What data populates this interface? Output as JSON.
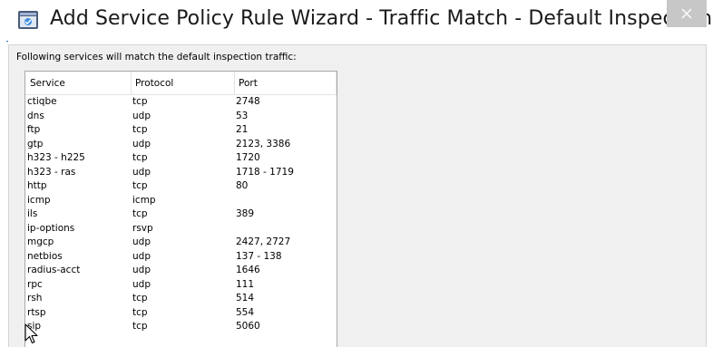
{
  "window": {
    "title": "Add Service Policy Rule Wizard - Traffic Match - Default Inspections",
    "close_glyph": "✕"
  },
  "intro_text": "Following services will match the default inspection traffic:",
  "table": {
    "columns": [
      "Service",
      "Protocol",
      "Port"
    ],
    "rows": [
      [
        "ctiqbe",
        "tcp",
        "2748"
      ],
      [
        "dns",
        "udp",
        "53"
      ],
      [
        "ftp",
        "tcp",
        "21"
      ],
      [
        "gtp",
        "udp",
        "2123, 3386"
      ],
      [
        "h323 - h225",
        "tcp",
        "1720"
      ],
      [
        "h323 - ras",
        "udp",
        "1718 - 1719"
      ],
      [
        "http",
        "tcp",
        "80"
      ],
      [
        "icmp",
        "icmp",
        ""
      ],
      [
        "ils",
        "tcp",
        "389"
      ],
      [
        "ip-options",
        "rsvp",
        ""
      ],
      [
        "mgcp",
        "udp",
        "2427, 2727"
      ],
      [
        "netbios",
        "udp",
        "137 - 138"
      ],
      [
        "radius-acct",
        "udp",
        "1646"
      ],
      [
        "rpc",
        "udp",
        "111"
      ],
      [
        "rsh",
        "tcp",
        "514"
      ],
      [
        "rtsp",
        "tcp",
        "554"
      ],
      [
        "sip",
        "tcp",
        "5060"
      ]
    ]
  },
  "icons": {
    "app": "wizard-window-icon",
    "close": "close-icon",
    "cursor": "mouse-pointer-icon"
  },
  "colors": {
    "close_button_bg": "#c7c7c7",
    "dialog_bg": "#f0f0f0",
    "accent": "#2b6cb0"
  }
}
